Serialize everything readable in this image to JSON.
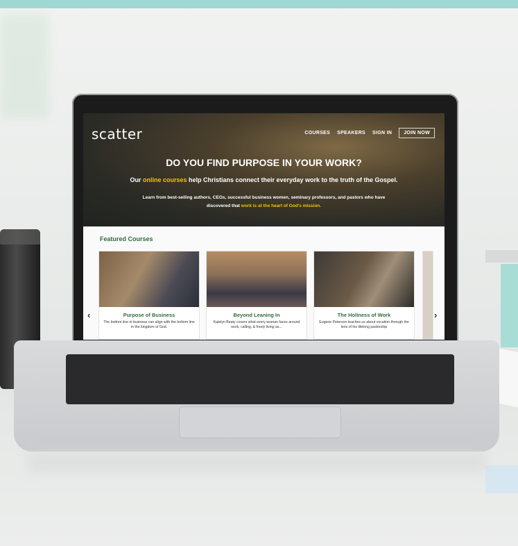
{
  "logo": "scatter",
  "nav": {
    "courses": "COURSES",
    "speakers": "SPEAKERS",
    "signin": "SIGN IN",
    "join": "JOIN NOW"
  },
  "hero": {
    "headline": "DO YOU FIND PURPOSE IN YOUR WORK?",
    "sub_pre": "Our ",
    "sub_highlight": "online courses",
    "sub_post": " help Christians connect their everyday work to the truth of the Gospel.",
    "small_line1": "Learn from best-selling authors, CEOs, successful business women, seminary professors, and pastors who have",
    "small_line2_pre": "discovered that ",
    "small_line2_highlight": "work is at the heart of God's mission."
  },
  "featured": {
    "title": "Featured Courses",
    "prev": "‹",
    "next": "›",
    "cards": [
      {
        "title": "Purpose of Business",
        "desc": "The bottom line in business can align with the bottom line in the kingdom of God."
      },
      {
        "title": "Beyond Leaning In",
        "desc": "Katelyn Beaty covers what every woman faces around work, calling, & freely living as..."
      },
      {
        "title": "The Holiness of Work",
        "desc": "Eugene Peterson teaches us about vocation through the lens of his lifelong pastorship"
      }
    ]
  },
  "colors": {
    "accent_green": "#2f6b3c",
    "highlight_yellow": "#f2c500",
    "top_bar": "#9fd8d2"
  }
}
